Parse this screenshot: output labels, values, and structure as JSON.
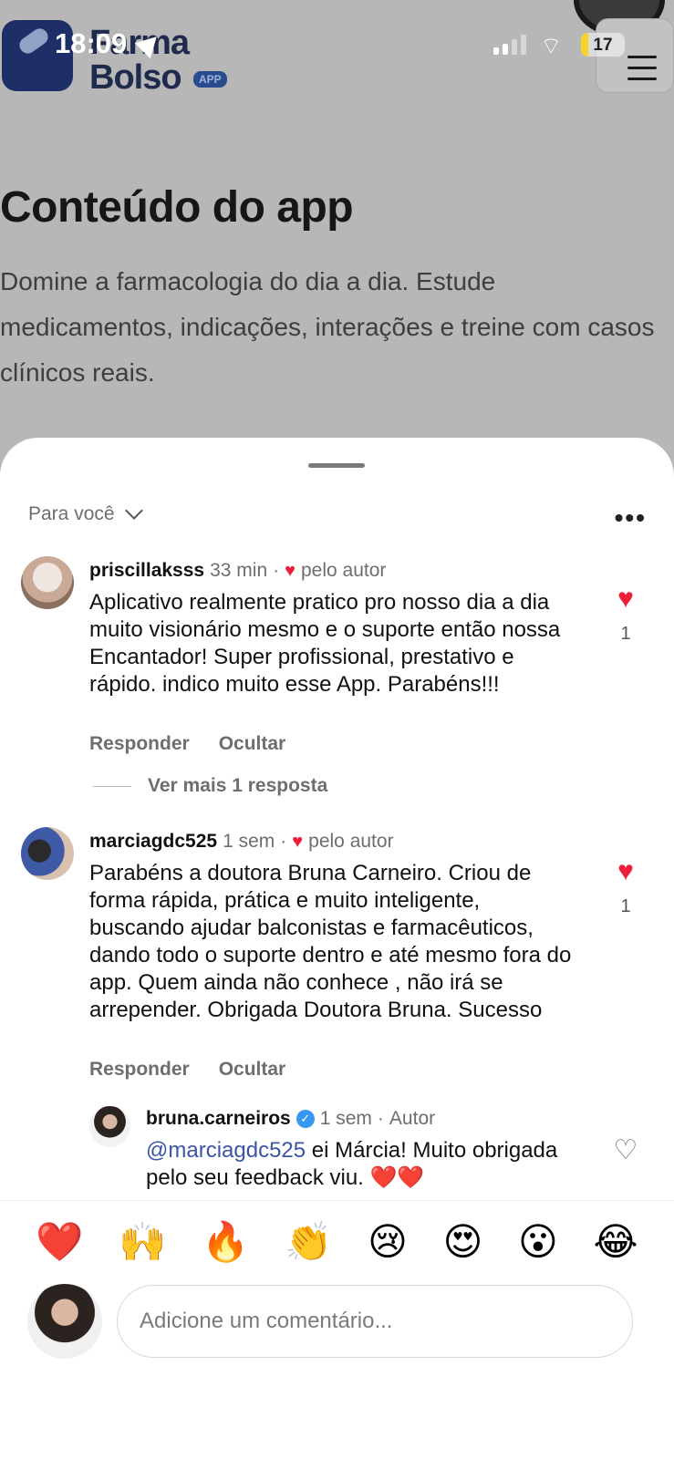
{
  "status_bar": {
    "time": "18:09",
    "battery": "17",
    "battery_level": 0.17
  },
  "background_page": {
    "logo_line1": "Farma",
    "logo_line2": "Bolso",
    "logo_badge": "APP",
    "title": "Conteúdo do app",
    "description": "Domine a farmacologia do dia a dia. Estude medicamentos, indicações, interações e treine com casos clínicos reais."
  },
  "sheet": {
    "sort_label": "Para você",
    "more_icon": "more-horizontal-icon"
  },
  "comments": [
    {
      "username": "priscillaksss",
      "time": "33 min",
      "separator": "·",
      "author_like": "pelo autor",
      "text": "Aplicativo realmente pratico pro nosso dia a dia muito visionário mesmo e o suporte então nossa Encantador! Super profissional, prestativo e rápido. indico muito esse App. Parabéns!!!",
      "likes": "1",
      "reply_label": "Responder",
      "hide_label": "Ocultar",
      "more_replies": "Ver mais 1 resposta"
    },
    {
      "username": "marciagdc525",
      "time": "1 sem",
      "separator": "·",
      "author_like": "pelo autor",
      "text": "Parabéns a doutora Bruna Carneiro. Criou de forma rápida, prática e muito inteligente, buscando ajudar balconistas e farmacêuticos, dando todo o suporte dentro e até mesmo fora do app. Quem ainda não conhece , não irá se arrepender. Obrigada Doutora Bruna. Sucesso",
      "likes": "1",
      "reply_label": "Responder",
      "hide_label": "Ocultar"
    }
  ],
  "reply": {
    "username": "bruna.carneiros",
    "time": "1 sem",
    "separator": "·",
    "role": "Autor",
    "mention": "@marciagdc525",
    "text": " ei Márcia! Muito obrigada pelo seu feedback viu. ❤️❤️"
  },
  "emoji_bar": [
    "❤️",
    "🙌",
    "🔥",
    "👏",
    "😢",
    "😍",
    "😮",
    "😂"
  ],
  "comment_input": {
    "placeholder": "Adicione um comentário..."
  },
  "colors": {
    "like_red": "#ee1d3a",
    "verified_blue": "#3897f0",
    "mention_blue": "#3b54a6"
  }
}
